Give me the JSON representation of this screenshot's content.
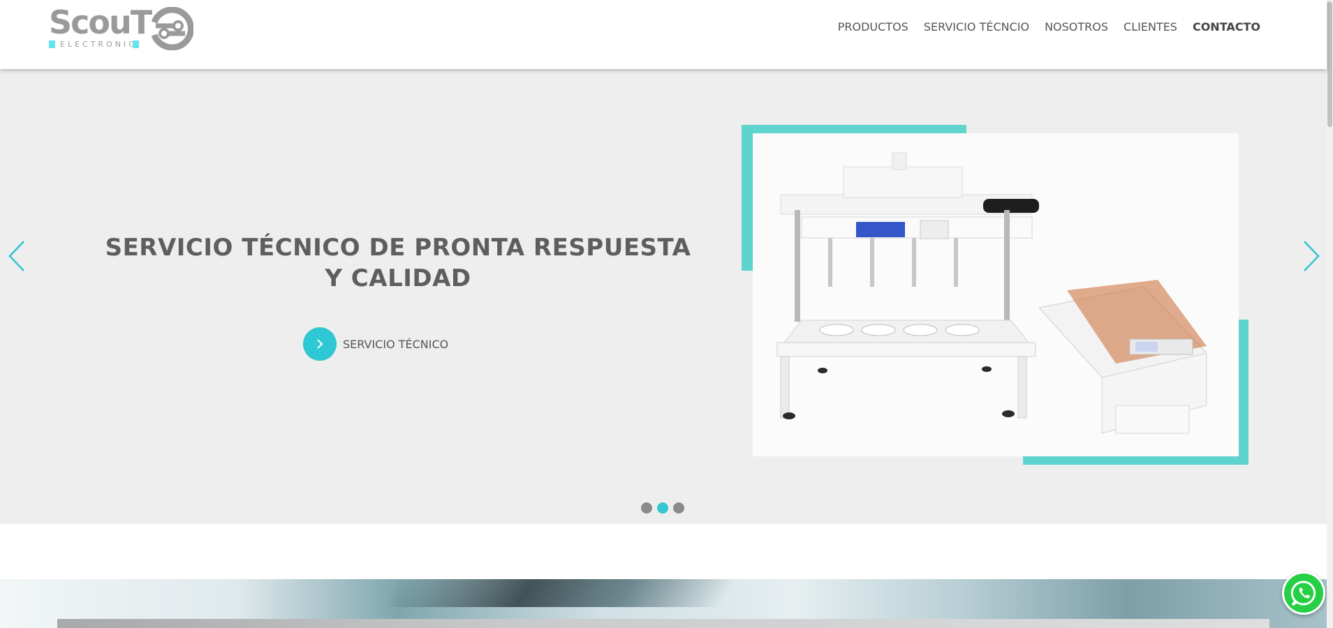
{
  "brand": {
    "logo_word": "ScouT",
    "logo_subtitle": "ELECTRONIC",
    "accent_color": "#2ec8d4",
    "frame_color": "#5fd3cd"
  },
  "nav": {
    "items": [
      {
        "label": "PRODUCTOS"
      },
      {
        "label": "SERVICIO TÉCNCIO"
      },
      {
        "label": "NOSOTROS"
      },
      {
        "label": "CLIENTES"
      },
      {
        "label": "CONTACTO"
      }
    ]
  },
  "hero": {
    "title": "SERVICIO TÉCNICO DE PRONTA RESPUESTA Y CALIDAD",
    "cta_label": "SERVICIO TÉCNICO",
    "cta_icon": "chevron-right-icon",
    "prev_icon": "chevron-left-icon",
    "next_icon": "chevron-right-icon",
    "slides_total": 3,
    "active_slide": 2
  },
  "floating": {
    "whatsapp_icon": "whatsapp-icon"
  }
}
